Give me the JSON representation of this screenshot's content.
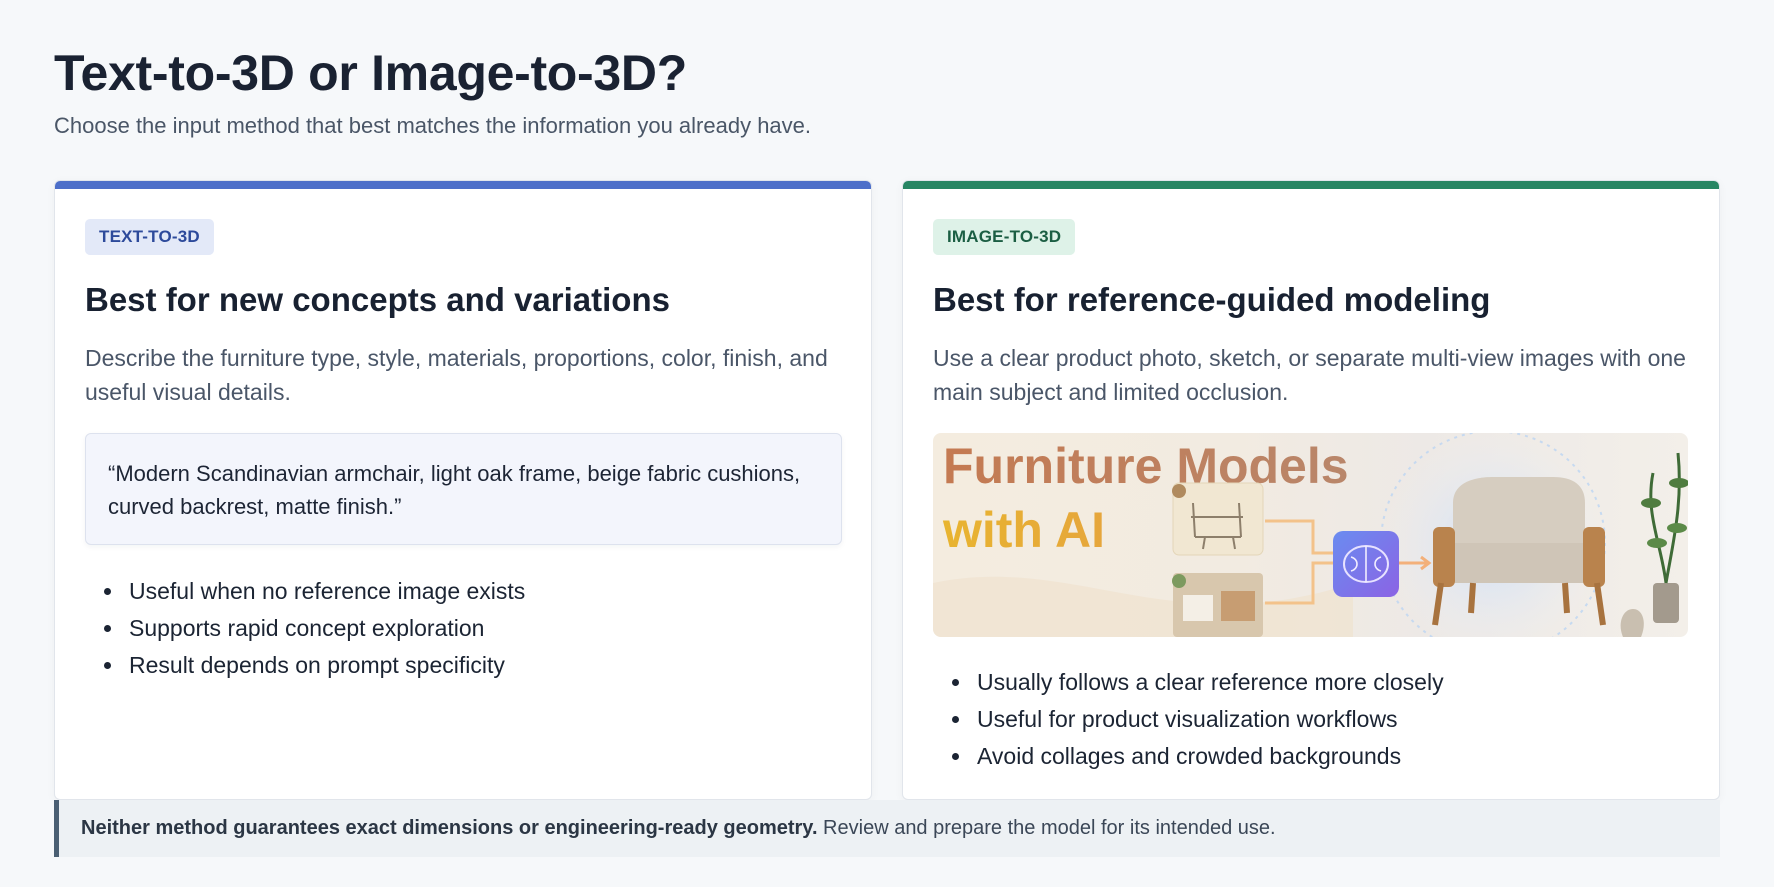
{
  "header": {
    "title": "Text-to-3D or Image-to-3D?",
    "subtitle": "Choose the input method that best matches the information you already have."
  },
  "text_card": {
    "badge": "TEXT-TO-3D",
    "title": "Best for new concepts and variations",
    "description": "Describe the furniture type, style, materials, proportions, color, finish, and useful visual details.",
    "example_prompt": "“Modern Scandinavian armchair, light oak frame, beige fabric cushions, curved backrest, matte finish.”",
    "bullets": [
      "Useful when no reference image exists",
      "Supports rapid concept exploration",
      "Result depends on prompt specificity"
    ],
    "accent_color": "#4d6fc9"
  },
  "image_card": {
    "badge": "IMAGE-TO-3D",
    "title": "Best for reference-guided modeling",
    "description": "Use a clear product photo, sketch, or separate multi-view images with one main subject and limited occlusion.",
    "illustration": {
      "line1": "Furniture Models",
      "line2": "with AI",
      "icons": [
        "armchair-sketch-icon",
        "room-photo-icon",
        "ai-brain-icon",
        "armchair-icon",
        "plant-icon"
      ]
    },
    "bullets": [
      "Usually follows a clear reference more closely",
      "Useful for product visualization workflows",
      "Avoid collages and crowded backgrounds"
    ],
    "accent_color": "#278563"
  },
  "note": {
    "emphasis": "Neither method guarantees exact dimensions or engineering-ready geometry.",
    "text": " Review and prepare the model for its intended use."
  }
}
